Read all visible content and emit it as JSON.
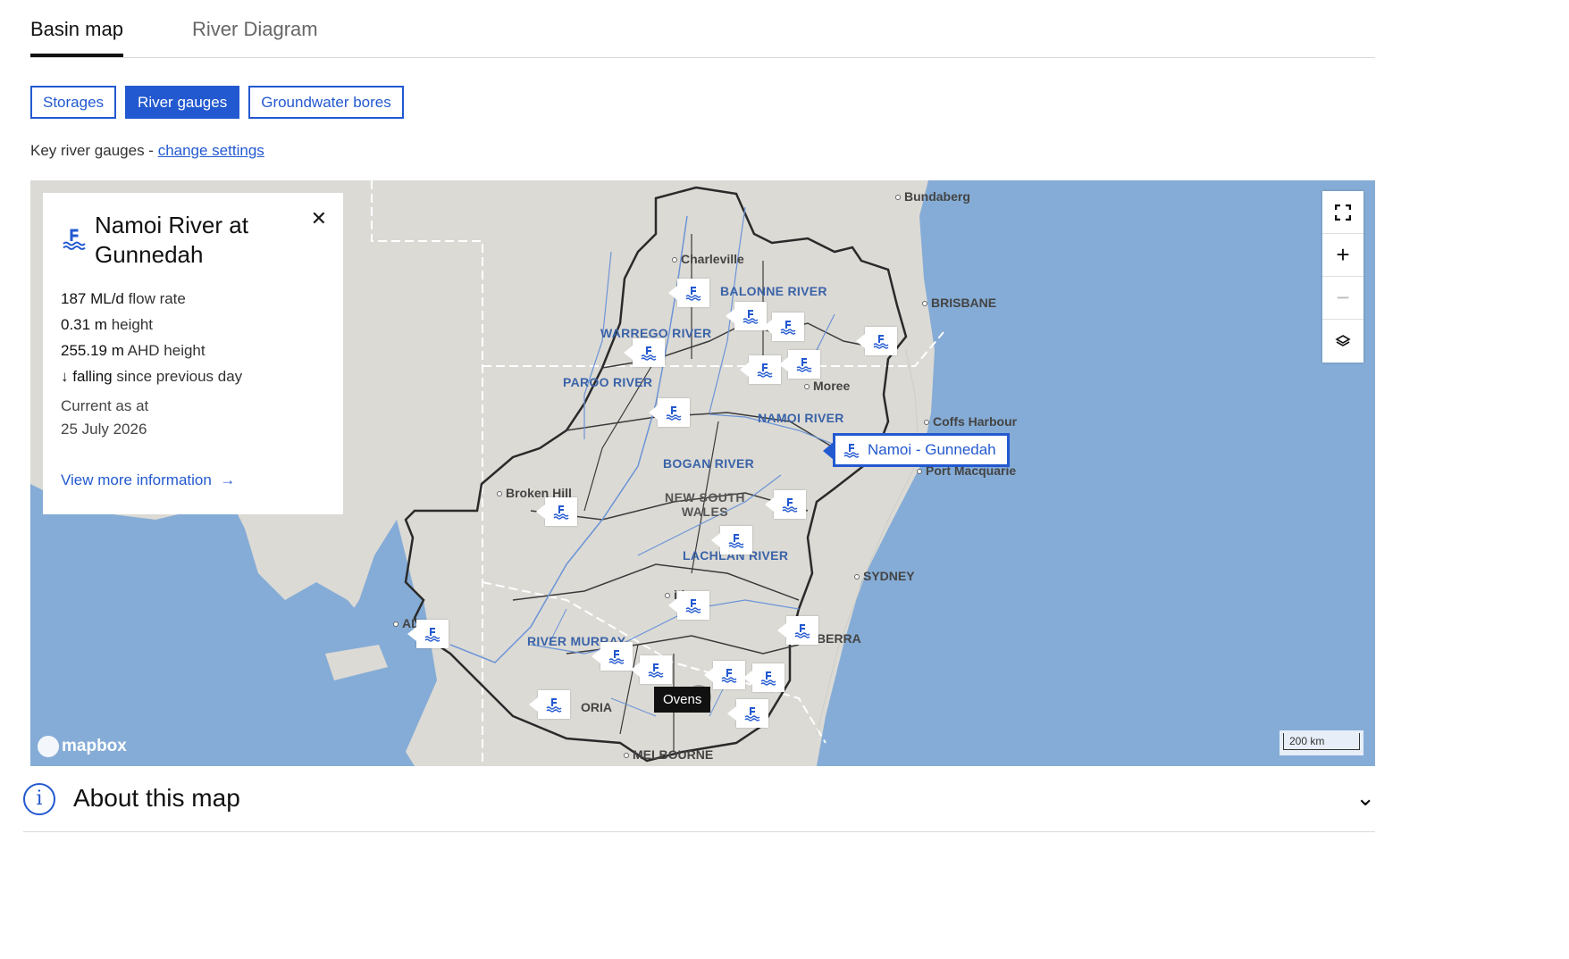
{
  "tabs": [
    {
      "label": "Basin map",
      "active": true
    },
    {
      "label": "River Diagram",
      "active": false
    }
  ],
  "filters": [
    {
      "label": "Storages",
      "active": false
    },
    {
      "label": "River gauges",
      "active": true
    },
    {
      "label": "Groundwater bores",
      "active": false
    }
  ],
  "key_line": {
    "text": "Key river gauges - ",
    "link": "change settings"
  },
  "popup": {
    "title": "Namoi River at Gunnedah",
    "flow_value": "187 ML/d",
    "flow_label": " flow rate",
    "height_value": "0.31 m",
    "height_label": " height",
    "ahd_value": "255.19 m",
    "ahd_label": " AHD height",
    "trend_value": "↓ falling",
    "trend_label": " since previous day",
    "current_as_at": "Current as at",
    "date": "25 July 2026",
    "more_link": "View more information"
  },
  "map": {
    "places": {
      "bundaberg": "Bundaberg",
      "brisbane": "BRISBANE",
      "charleville": "Charleville",
      "moree": "Moree",
      "coffs": "Coffs Harbour",
      "port_macquarie": "Port Macquarie",
      "broken_hill": "Broken Hill",
      "sydney": "SYDNEY",
      "canberra": "BERRA",
      "melbourne": "MELBOURNE",
      "adelaide": "AD",
      "victoria": "ORIA",
      "griffith": "ith"
    },
    "rivers": {
      "balonne": "BALONNE RIVER",
      "warrego": "WARREGO RIVER",
      "paroo": "PAROO RIVER",
      "namoi": "NAMOI RIVER",
      "bogan": "BOGAN RIVER",
      "lachlan": "LACHLAN RIVER",
      "murray": "RIVER MURRAY"
    },
    "region": "NEW SOUTH WALES",
    "selected_gauge": "Namoi - Gunnedah",
    "tooltip": "Ovens",
    "scale": "200 km",
    "attribution": "mapbox"
  },
  "about": {
    "title": "About this map",
    "icon": "i"
  },
  "colors": {
    "accent": "#2359d0",
    "water": "#85acd6",
    "land": "#dcdad5"
  }
}
